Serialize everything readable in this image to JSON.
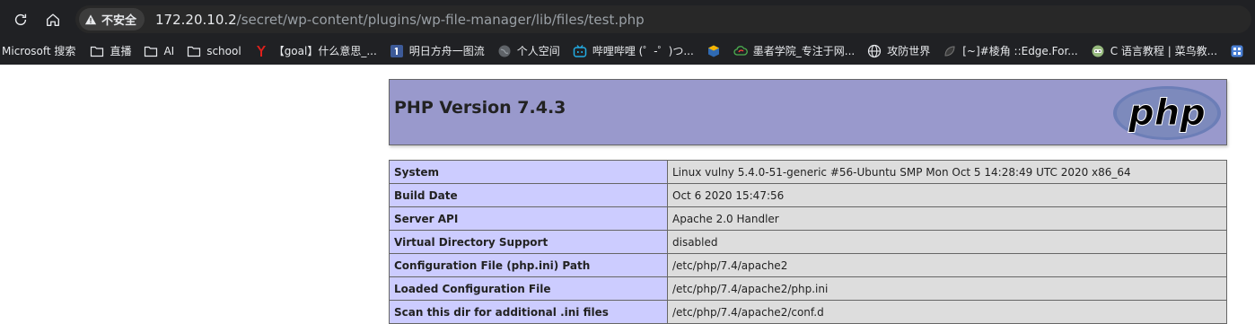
{
  "browser": {
    "security_label": "不安全",
    "url_host": "172.20.10.2",
    "url_path": "/secret/wp-content/plugins/wp-file-manager/lib/files/test.php",
    "bookmarks": [
      {
        "label": "Microsoft 搜索",
        "icon": "none"
      },
      {
        "label": "直播",
        "icon": "folder-icon"
      },
      {
        "label": "AI",
        "icon": "folder-icon"
      },
      {
        "label": "school",
        "icon": "folder-icon"
      },
      {
        "label": "【goal】什么意思_...",
        "icon": "youdao-icon"
      },
      {
        "label": "明日方舟一图流",
        "icon": "number-one-icon"
      },
      {
        "label": "个人空间",
        "icon": "globe-grey-icon"
      },
      {
        "label": "哔哩哔哩 (゜-゜)つ...",
        "icon": "bilibili-icon"
      },
      {
        "label": "",
        "icon": "box-icon"
      },
      {
        "label": "墨者学院_专注于网...",
        "icon": "cloud-icon"
      },
      {
        "label": "攻防世界",
        "icon": "globe-icon"
      },
      {
        "label": "[~]#棱角 ::Edge.For...",
        "icon": "dark-leaf-icon"
      },
      {
        "label": "C 语言教程 | 菜鸟教...",
        "icon": "runoob-icon"
      },
      {
        "label": "",
        "icon": "square-icon"
      }
    ]
  },
  "php": {
    "title": "PHP Version 7.4.3",
    "logo_text": "php",
    "rows": [
      {
        "key": "System",
        "value": "Linux vulny 5.4.0-51-generic #56-Ubuntu SMP Mon Oct 5 14:28:49 UTC 2020 x86_64"
      },
      {
        "key": "Build Date",
        "value": "Oct 6 2020 15:47:56"
      },
      {
        "key": "Server API",
        "value": "Apache 2.0 Handler"
      },
      {
        "key": "Virtual Directory Support",
        "value": "disabled"
      },
      {
        "key": "Configuration File (php.ini) Path",
        "value": "/etc/php/7.4/apache2"
      },
      {
        "key": "Loaded Configuration File",
        "value": "/etc/php/7.4/apache2/php.ini"
      },
      {
        "key": "Scan this dir for additional .ini files",
        "value": "/etc/php/7.4/apache2/conf.d"
      }
    ]
  },
  "colors": {
    "chrome_bg": "#202124",
    "header_bg": "#9999cc",
    "key_bg": "#ccccff",
    "value_bg": "#dddddd"
  }
}
